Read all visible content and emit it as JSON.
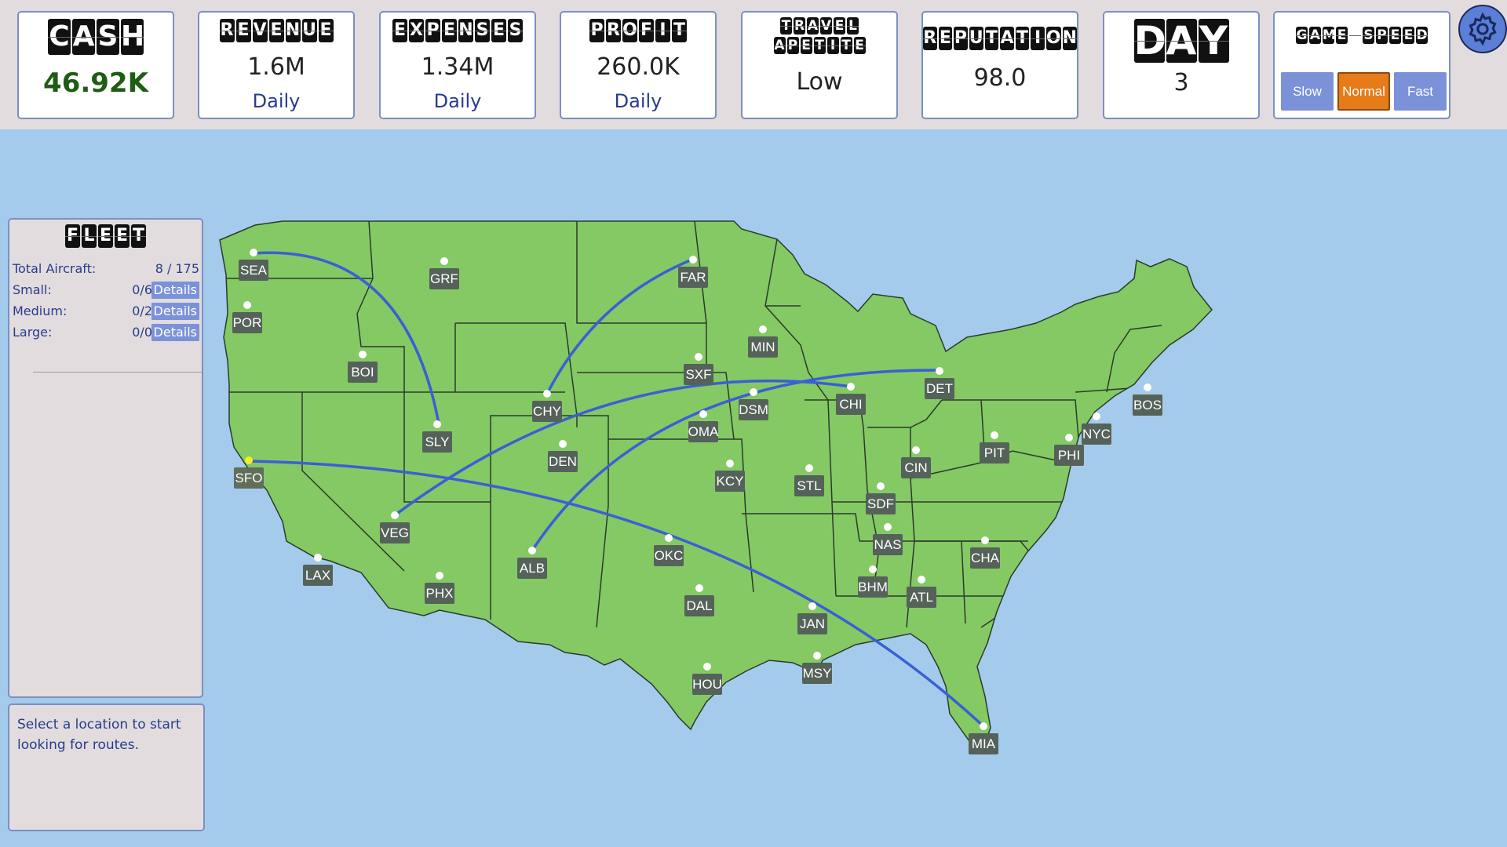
{
  "stats": {
    "cash": {
      "title": "CASH",
      "value": "46.92K"
    },
    "revenue": {
      "title": "REVENUE",
      "value": "1.6M",
      "period": "Daily"
    },
    "expenses": {
      "title": "EXPENSES",
      "value": "1.34M",
      "period": "Daily"
    },
    "profit": {
      "title": "PROFIT",
      "value": "260.0K",
      "period": "Daily"
    },
    "travel": {
      "title_line1": "TRAVEL",
      "title_line2": "APETITE",
      "value": "Low"
    },
    "reputation": {
      "title": "REPUTATION",
      "value": "98.0"
    },
    "day": {
      "title": "DAY",
      "value": "3"
    }
  },
  "game_speed": {
    "title": "GAME SPEED",
    "options": [
      "Slow",
      "Normal",
      "Fast"
    ],
    "selected": "Normal"
  },
  "fleet": {
    "title": "FLEET",
    "total_label": "Total Aircraft:",
    "total_value": "8 / 175",
    "rows": [
      {
        "label": "Small:",
        "count": "0/6",
        "action": "Details"
      },
      {
        "label": "Medium:",
        "count": "0/2",
        "action": "Details"
      },
      {
        "label": "Large:",
        "count": "0/0",
        "action": "Details"
      }
    ]
  },
  "info_message": "Select a location to start looking for routes.",
  "colors": {
    "land": "#84c964",
    "water": "#a4cbeb",
    "route": "#3a5fd6",
    "panel": "#e2dcde",
    "selected_label": "#f2ee2a",
    "accent": "#e67b19"
  },
  "icons": {
    "settings": "gear-icon"
  },
  "map": {
    "selected_city": "SFO",
    "cities": [
      "SEA",
      "POR",
      "BOI",
      "GRF",
      "FAR",
      "MIN",
      "SXF",
      "CHY",
      "SLY",
      "DSM",
      "OMA",
      "CHI",
      "DET",
      "BOS",
      "NYC",
      "PHI",
      "PIT",
      "CIN",
      "SDF",
      "DEN",
      "KCY",
      "STL",
      "SFO",
      "VEG",
      "LAX",
      "PHX",
      "ALB",
      "OKC",
      "DAL",
      "JAN",
      "NAS",
      "BHM",
      "ATL",
      "CHA",
      "MSY",
      "HOU",
      "MIA"
    ],
    "routes": [
      [
        "SEA",
        "SLY"
      ],
      [
        "CHY",
        "FAR"
      ],
      [
        "VEG",
        "CHI"
      ],
      [
        "ALB",
        "DET"
      ],
      [
        "SFO",
        "MIA"
      ]
    ]
  }
}
